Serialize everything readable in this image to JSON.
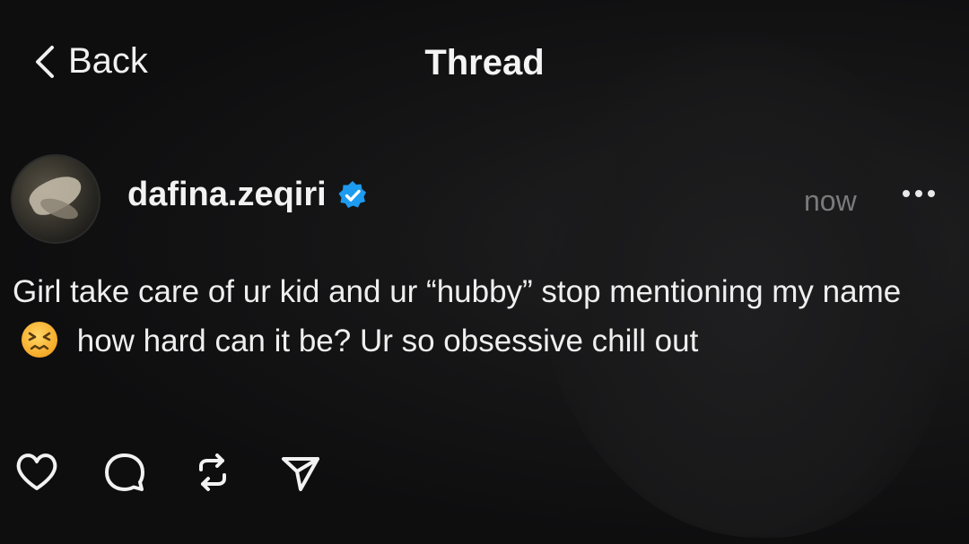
{
  "nav": {
    "back_label": "Back",
    "title": "Thread"
  },
  "post": {
    "username": "dafina.zeqiri",
    "verified": true,
    "timestamp": "now",
    "text_part1": "Girl take care of ur kid and ur “hubby” stop mentioning my name",
    "emoji": "confounded-face",
    "text_part2": "how hard can it be? Ur so obsessive chill out"
  },
  "actions": [
    "heart-icon",
    "comment-icon",
    "repost-icon",
    "share-icon"
  ],
  "colors": {
    "background": "#0e0e0f",
    "text": "#f2f2f2",
    "muted": "#7a7a7c",
    "verified_blue": "#1d9bf0"
  }
}
